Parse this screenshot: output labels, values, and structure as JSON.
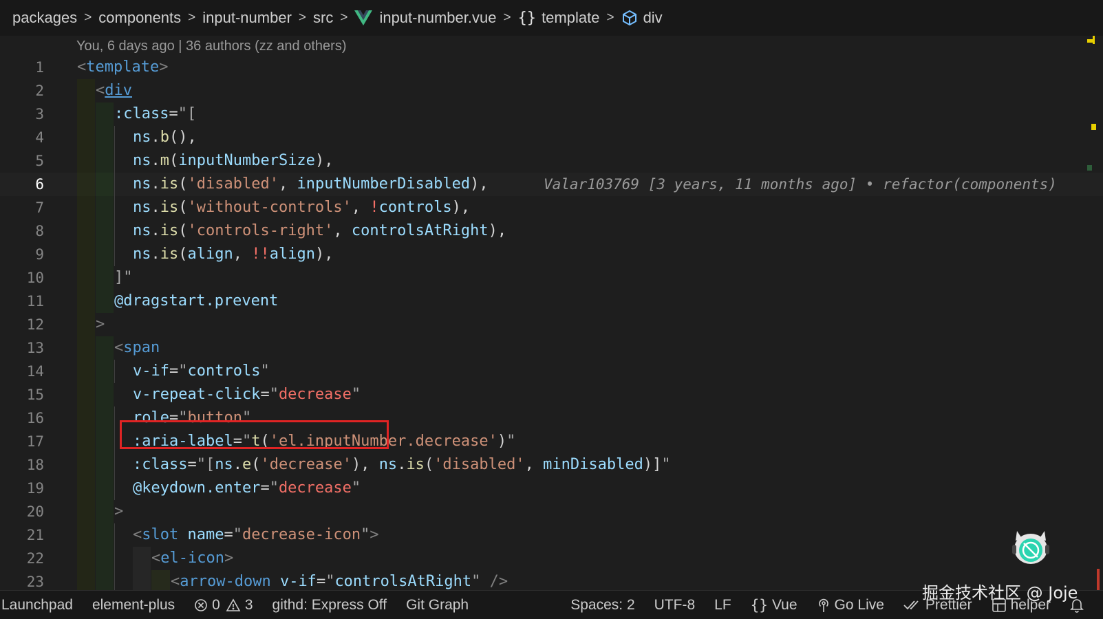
{
  "breadcrumb": {
    "items": [
      "packages",
      "components",
      "input-number",
      "src",
      "input-number.vue",
      "template",
      "div"
    ],
    "separator": ">"
  },
  "blame_header": "You, 6 days ago | 36 authors (zz and others)",
  "inline_blame": "Valar103769 [3 years, 11 months ago] • refactor(components)",
  "line_numbers": [
    "1",
    "2",
    "3",
    "4",
    "5",
    "6",
    "7",
    "8",
    "9",
    "10",
    "11",
    "12",
    "13",
    "14",
    "15",
    "16",
    "17",
    "18",
    "19",
    "20",
    "21",
    "22",
    "23"
  ],
  "active_line": "6",
  "code_tokens": {
    "l1": [
      "<",
      "template",
      ">"
    ],
    "l2": [
      "<",
      "div"
    ],
    "l3": [
      ":class",
      "=",
      "\"["
    ],
    "l4": [
      "ns",
      ".",
      "b",
      "()",
      ","
    ],
    "l5": [
      "ns",
      ".",
      "m",
      "(",
      "inputNumberSize",
      ")",
      ","
    ],
    "l6": [
      "ns",
      ".",
      "is",
      "(",
      "'disabled'",
      ", ",
      "inputNumberDisabled",
      ")",
      ","
    ],
    "l7": [
      "ns",
      ".",
      "is",
      "(",
      "'without-controls'",
      ", ",
      "!",
      "controls",
      ")",
      ","
    ],
    "l8": [
      "ns",
      ".",
      "is",
      "(",
      "'controls-right'",
      ", ",
      "controlsAtRight",
      ")",
      ","
    ],
    "l9": [
      "ns",
      ".",
      "is",
      "(",
      "align",
      ", ",
      "!!",
      "align",
      ")",
      ","
    ],
    "l10": [
      "]\""
    ],
    "l11": [
      "@dragstart.prevent"
    ],
    "l12": [
      ">"
    ],
    "l13": [
      "<",
      "span"
    ],
    "l14": [
      "v-if",
      "=",
      "\"",
      "controls",
      "\""
    ],
    "l15": [
      "v-repeat-click",
      "=",
      "\"",
      "decrease",
      "\""
    ],
    "l16": [
      "role",
      "=",
      "\"",
      "button",
      "\""
    ],
    "l17": [
      ":aria-label",
      "=",
      "\"",
      "t",
      "(",
      "'el.inputNumber.decrease'",
      ")",
      "\""
    ],
    "l18": [
      ":class",
      "=",
      "\"[",
      "ns",
      ".",
      "e",
      "(",
      "'decrease'",
      "), ",
      "ns",
      ".",
      "is",
      "(",
      "'disabled'",
      ", ",
      "minDisabled",
      ")]",
      "\""
    ],
    "l19": [
      "@keydown.enter",
      "=",
      "\"",
      "decrease",
      "\""
    ],
    "l20": [
      ">"
    ],
    "l21": [
      "<",
      "slot",
      " name",
      "=",
      "\"",
      "decrease-icon",
      "\"",
      ">"
    ],
    "l22": [
      "<",
      "el-icon",
      ">"
    ],
    "l23": [
      "<",
      "arrow-down",
      " v-if",
      "=",
      "\"",
      "controlsAtRight",
      "\"",
      " />"
    ]
  },
  "statusbar": {
    "launchpad": "Launchpad",
    "project": "element-plus",
    "errors": "0",
    "warnings": "3",
    "githd": "githd: Express Off",
    "git_graph": "Git Graph",
    "spaces": "Spaces: 2",
    "encoding": "UTF-8",
    "eol": "LF",
    "language": "Vue",
    "go_live": "Go Live",
    "prettier": "Prettier",
    "helper": "helper"
  },
  "watermark": "掘金技术社区 @ Joje",
  "icons": {
    "vue": "vue-logo-icon",
    "braces": "braces-icon",
    "cube": "cube-icon",
    "error": "error-circle-icon",
    "warning": "warning-triangle-icon",
    "braces_lang": "braces-icon",
    "broadcast": "broadcast-icon",
    "check": "double-check-icon",
    "helper": "helper-icon",
    "bell": "bell-icon",
    "mascot": "mascot-icon"
  },
  "colors": {
    "background": "#1e1e1e",
    "tag": "#569cd6",
    "attribute": "#9cdcfe",
    "string": "#ce9178",
    "function": "#dcdcaa",
    "highlight_box": "#e02424"
  }
}
